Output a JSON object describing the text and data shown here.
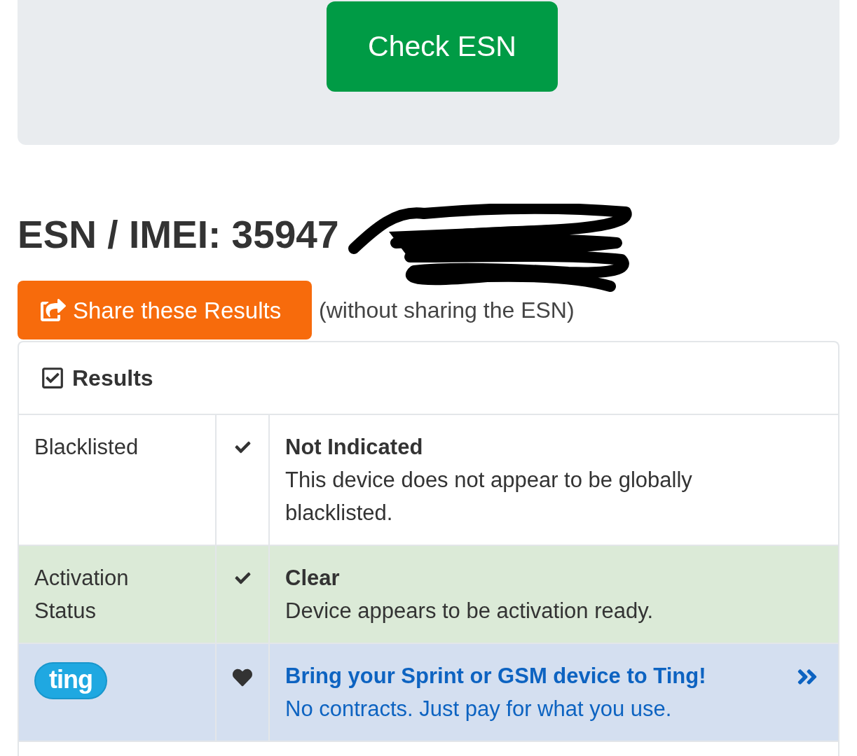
{
  "search_panel": {
    "button": "Check ESN"
  },
  "heading": "ESN / IMEI: 35947",
  "share": {
    "button": "Share these Results",
    "note": "(without sharing the ESN)"
  },
  "results": {
    "title": "Results",
    "rows": [
      {
        "kind": "check",
        "label": "Blacklisted",
        "status": "Not Indicated",
        "detail": "This device does not appear to be globally blacklisted.",
        "color": "#ffffff"
      },
      {
        "kind": "check",
        "label": "Activation Status",
        "status": "Clear",
        "detail": "Device appears to be activation ready.",
        "color": "#dbead7"
      },
      {
        "kind": "promo",
        "logo": "ting",
        "title": "Bring your Sprint or GSM device to Ting!",
        "detail": "No contracts. Just pay for what you use.",
        "color": "#d4dff0"
      }
    ]
  }
}
